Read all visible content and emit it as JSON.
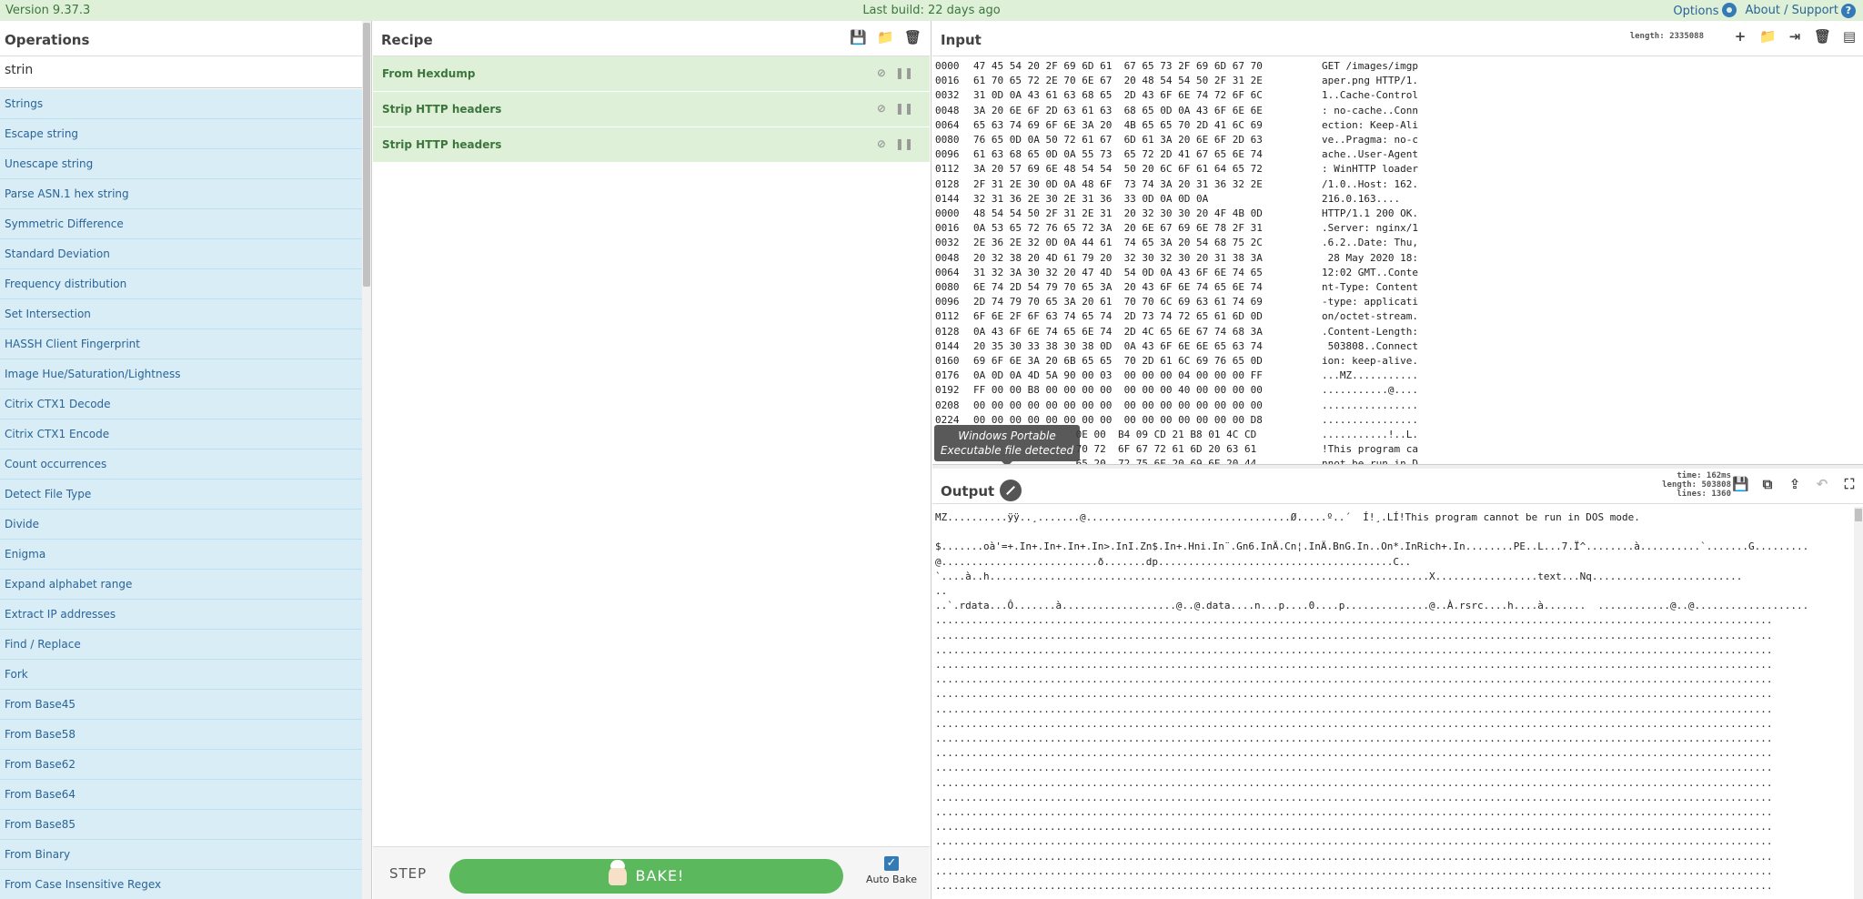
{
  "banner": {
    "version": "Version 9.37.3",
    "last_build": "Last build: 22 days ago",
    "options": "Options",
    "about": "About / Support"
  },
  "operations": {
    "title": "Operations",
    "search_value": "strin",
    "items": [
      "Strings",
      "Escape string",
      "Unescape string",
      "Parse ASN.1 hex string",
      "Symmetric Difference",
      "Standard Deviation",
      "Frequency distribution",
      "Set Intersection",
      "HASSH Client Fingerprint",
      "Image Hue/Saturation/Lightness",
      "Citrix CTX1 Decode",
      "Citrix CTX1 Encode",
      "Count occurrences",
      "Detect File Type",
      "Divide",
      "Enigma",
      "Expand alphabet range",
      "Extract IP addresses",
      "Find / Replace",
      "Fork",
      "From Base45",
      "From Base58",
      "From Base62",
      "From Base64",
      "From Base85",
      "From Binary",
      "From Case Insensitive Regex"
    ]
  },
  "recipe": {
    "title": "Recipe",
    "steps": [
      "From Hexdump",
      "Strip HTTP headers",
      "Strip HTTP headers"
    ],
    "step_label": "STEP",
    "bake_label": "BAKE!",
    "auto_bake_label": "Auto Bake"
  },
  "input": {
    "title": "Input",
    "length": "length: 2335088",
    "hex_rows": [
      [
        "0000",
        "47 45 54 20 2F 69 6D 61  67 65 73 2F 69 6D 67 70",
        "GET /images/imgp"
      ],
      [
        "0016",
        "61 70 65 72 2E 70 6E 67  20 48 54 54 50 2F 31 2E",
        "aper.png HTTP/1."
      ],
      [
        "0032",
        "31 0D 0A 43 61 63 68 65  2D 43 6F 6E 74 72 6F 6C",
        "1..Cache-Control"
      ],
      [
        "0048",
        "3A 20 6E 6F 2D 63 61 63  68 65 0D 0A 43 6F 6E 6E",
        ": no-cache..Conn"
      ],
      [
        "0064",
        "65 63 74 69 6F 6E 3A 20  4B 65 65 70 2D 41 6C 69",
        "ection: Keep-Ali"
      ],
      [
        "0080",
        "76 65 0D 0A 50 72 61 67  6D 61 3A 20 6E 6F 2D 63",
        "ve..Pragma: no-c"
      ],
      [
        "0096",
        "61 63 68 65 0D 0A 55 73  65 72 2D 41 67 65 6E 74",
        "ache..User-Agent"
      ],
      [
        "0112",
        "3A 20 57 69 6E 48 54 54  50 20 6C 6F 61 64 65 72",
        ": WinHTTP loader"
      ],
      [
        "0128",
        "2F 31 2E 30 0D 0A 48 6F  73 74 3A 20 31 36 32 2E",
        "/1.0..Host: 162."
      ],
      [
        "0144",
        "32 31 36 2E 30 2E 31 36  33 0D 0A 0D 0A",
        "216.0.163...."
      ],
      [
        "0000",
        "48 54 54 50 2F 31 2E 31  20 32 30 30 20 4F 4B 0D",
        "HTTP/1.1 200 OK."
      ],
      [
        "0016",
        "0A 53 65 72 76 65 72 3A  20 6E 67 69 6E 78 2F 31",
        ".Server: nginx/1"
      ],
      [
        "0032",
        "2E 36 2E 32 0D 0A 44 61  74 65 3A 20 54 68 75 2C",
        ".6.2..Date: Thu,"
      ],
      [
        "0048",
        "20 32 38 20 4D 61 79 20  32 30 32 30 20 31 38 3A",
        " 28 May 2020 18:"
      ],
      [
        "0064",
        "31 32 3A 30 32 20 47 4D  54 0D 0A 43 6F 6E 74 65",
        "12:02 GMT..Conte"
      ],
      [
        "0080",
        "6E 74 2D 54 79 70 65 3A  20 43 6F 6E 74 65 6E 74",
        "nt-Type: Content"
      ],
      [
        "0096",
        "2D 74 79 70 65 3A 20 61  70 70 6C 69 63 61 74 69",
        "-type: applicati"
      ],
      [
        "0112",
        "6F 6E 2F 6F 63 74 65 74  2D 73 74 72 65 61 6D 0D",
        "on/octet-stream."
      ],
      [
        "0128",
        "0A 43 6F 6E 74 65 6E 74  2D 4C 65 6E 67 74 68 3A",
        ".Content-Length:"
      ],
      [
        "0144",
        "20 35 30 33 38 30 38 0D  0A 43 6F 6E 6E 65 63 74",
        " 503808..Connect"
      ],
      [
        "0160",
        "69 6F 6E 3A 20 6B 65 65  70 2D 61 6C 69 76 65 0D",
        "ion: keep-alive."
      ],
      [
        "0176",
        "0A 0D 0A 4D 5A 90 00 03  00 00 00 04 00 00 00 FF",
        "...MZ..........."
      ],
      [
        "0192",
        "FF 00 00 B8 00 00 00 00  00 00 00 40 00 00 00 00",
        "...........@...."
      ],
      [
        "0208",
        "00 00 00 00 00 00 00 00  00 00 00 00 00 00 00 00",
        "................"
      ],
      [
        "0224",
        "00 00 00 00 00 00 00 00  00 00 00 00 00 00 00 D8",
        "................"
      ],
      [
        "",
        "                 0E 00  B4 09 CD 21 B8 01 4C CD",
        "...........!..L."
      ],
      [
        "",
        "                 70 72  6F 67 72 61 6D 20 63 61",
        "!This program ca"
      ],
      [
        "",
        "                 65 20  72 75 6E 20 69 6E 20 44",
        "nnot be run in D"
      ]
    ],
    "magic_tooltip_line1": "Windows Portable",
    "magic_tooltip_line2": "Executable file detected"
  },
  "output": {
    "title": "Output",
    "time": "time: 162ms",
    "length": "length: 503808",
    "lines": "lines: 1360",
    "lines_text": [
      "MZ..........ÿÿ..¸.......@..................................Ø.....º..´  Í!¸.LÍ!This program cannot be run in DOS mode.",
      "",
      "$.......oà'=+.In+.In+.In+.In>.InI.Zn$.In+.Hni.In¨.Gn6.InÄ.Cn¦.InÄ.BnG.In..On*.InRich+.In........PE..L...7.Ï^........à..........`.......G.........",
      "@..........................ð.......dp.......................................C..",
      "`....à..h.........................................................................X.................text...Nq.........................",
      "..",
      "..`.rdata...Ô.......à...................@..@.data....n...p....0....p..............@..À.rsrc....h....à.......  ............@..@...................",
      "...........................................................................................................................................",
      "...........................................................................................................................................",
      "...........................................................................................................................................",
      "...........................................................................................................................................",
      "...........................................................................................................................................",
      "...........................................................................................................................................",
      "...........................................................................................................................................",
      "...........................................................................................................................................",
      "...........................................................................................................................................",
      "...........................................................................................................................................",
      "...........................................................................................................................................",
      "...........................................................................................................................................",
      "...........................................................................................................................................",
      "...........................................................................................................................................",
      "...........................................................................................................................................",
      "...........................................................................................................................................",
      "...........................................................................................................................................",
      "...........................................................................................................................................",
      "..........................................................................................................................................."
    ]
  }
}
